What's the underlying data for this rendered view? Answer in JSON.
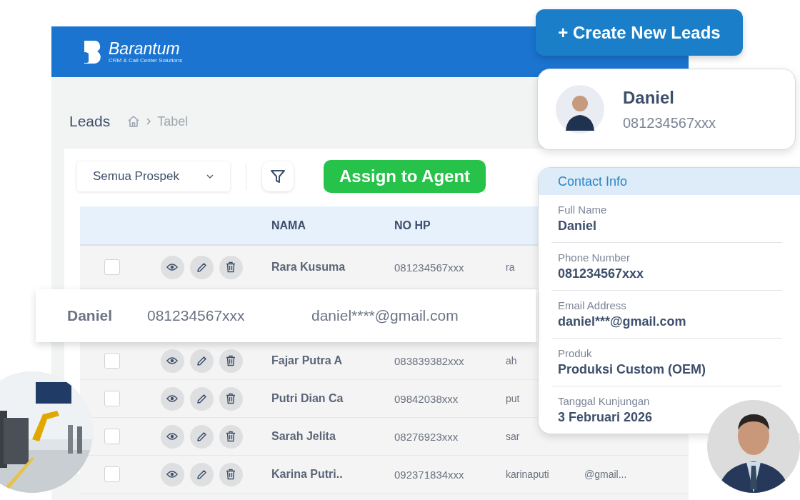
{
  "brand": {
    "name": "Barantum",
    "tagline": "CRM & Call Center Solutions"
  },
  "page": {
    "title": "Leads",
    "breadcrumb": "Tabel"
  },
  "toolbar": {
    "filter": "Semua Prospek",
    "assign_button": "Assign to Agent"
  },
  "table": {
    "columns": [
      "NAMA",
      "NO HP"
    ],
    "rows": [
      {
        "kind": "row",
        "checked": false,
        "name": "Rara Kusuma",
        "phone": "081234567xxx",
        "column_3": "ra"
      },
      {
        "kind": "highlight",
        "name": "Daniel",
        "phone": "081234567xxx",
        "email": "daniel****@gmail.com"
      },
      {
        "kind": "row",
        "checked": false,
        "name": "Fajar Putra A",
        "phone": "083839382xxx",
        "column_3": "ah"
      },
      {
        "kind": "row",
        "checked": false,
        "name": "Putri Dian Ca",
        "phone": "09842038xxx",
        "column_3": "put"
      },
      {
        "kind": "row",
        "checked": false,
        "name": "Sarah Jelita",
        "phone": "08276923xxx",
        "column_3": "sar"
      },
      {
        "kind": "row",
        "checked": false,
        "name": "Karina Putri..",
        "phone": "092371834xxx",
        "column_3": "karinaputi",
        "column_4": "@gmail..."
      }
    ]
  },
  "create_button": "+ Create New Leads",
  "profile": {
    "name": "Daniel",
    "phone": "081234567xxx"
  },
  "contact_info": {
    "title": "Contact Info",
    "fields": [
      {
        "label": "Full Name",
        "value": "Daniel"
      },
      {
        "label": "Phone Number",
        "value": "081234567xxx"
      },
      {
        "label": "Email Address",
        "value": "daniel***@gmail.com"
      },
      {
        "label": "Produk",
        "value": "Produksi Custom (OEM)"
      },
      {
        "label": "Tanggal Kunjungan",
        "value": "3 Februari 2026"
      }
    ]
  }
}
